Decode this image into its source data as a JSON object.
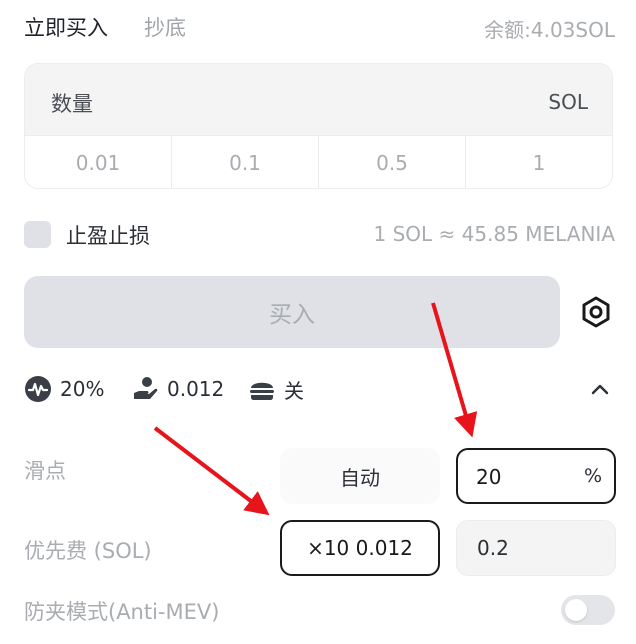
{
  "tabs": {
    "active": "立即买入",
    "inactive": "抄底"
  },
  "balance": "余额:4.03SOL",
  "amount": {
    "label": "数量",
    "unit": "SOL",
    "presets": [
      "0.01",
      "0.1",
      "0.5",
      "1"
    ]
  },
  "take_profit_stop_loss": {
    "label": "止盈止损",
    "checked": false
  },
  "rate": "1 SOL ≈ 45.85 MELANIA",
  "buy_button": "买入",
  "summary": {
    "slippage": "20%",
    "priority_fee": "0.012",
    "anti_mev": "关"
  },
  "slippage": {
    "label": "滑点",
    "auto_label": "自动",
    "value": "20",
    "unit": "%"
  },
  "priority_fee": {
    "label": "优先费 (SOL)",
    "multiplier": "×10 0.012",
    "value": "0.2"
  },
  "anti_mev": {
    "label": "防夹模式(Anti-MEV)",
    "enabled": false
  },
  "colors": {
    "annotation_arrow": "#e8141c",
    "disabled_button": "#dfe1e6"
  }
}
